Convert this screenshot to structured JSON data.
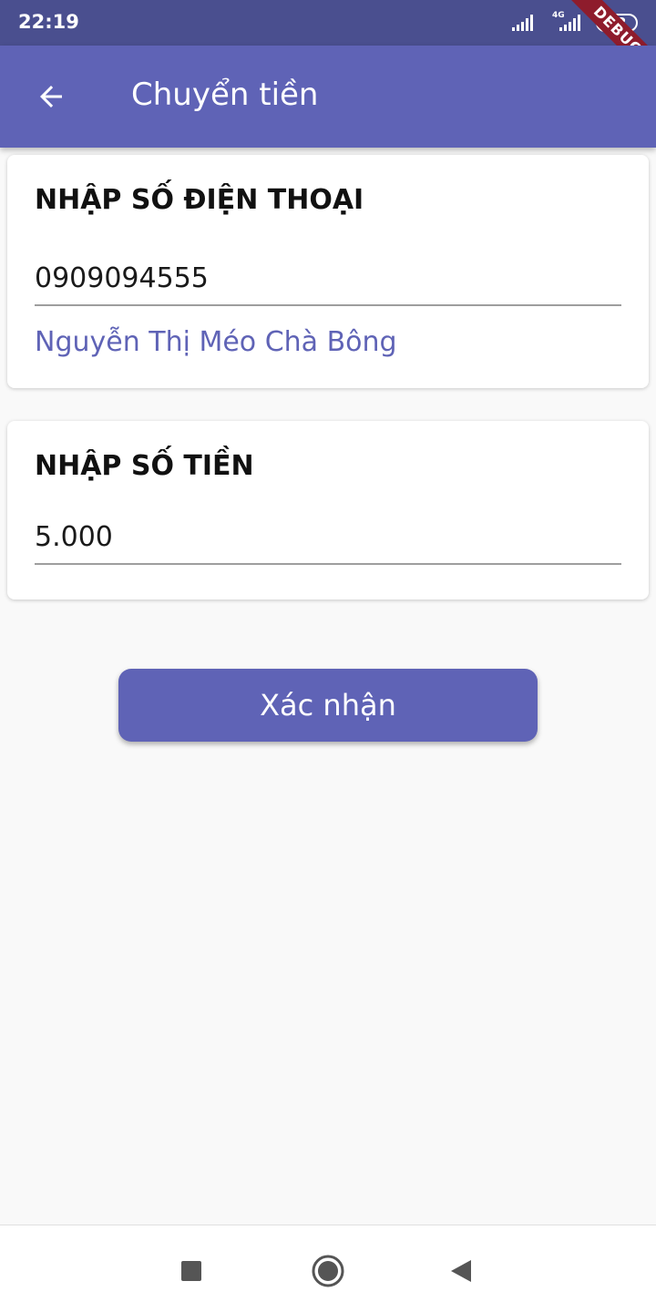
{
  "status_bar": {
    "time": "22:19",
    "network": "4G",
    "battery": "62",
    "debug_label": "DEBUG"
  },
  "app_bar": {
    "title": "Chuyển tiền",
    "back_icon": "arrow-left-icon"
  },
  "phone_card": {
    "label": "NHẬP SỐ ĐIỆN THOẠI",
    "value": "0909094555",
    "recipient_name": "Nguyễn Thị Méo Chà Bông"
  },
  "amount_card": {
    "label": "NHẬP SỐ TIỀN",
    "value": "5.000"
  },
  "confirm_button": {
    "label": "Xác nhận"
  },
  "nav_bar": {
    "icons": [
      "square-recents-icon",
      "circle-home-icon",
      "triangle-back-icon"
    ]
  },
  "colors": {
    "primary": "#5f63b6",
    "status_bar": "#4a4f8f",
    "background": "#f9f9f9",
    "debug_ribbon": "#8e1c2c"
  }
}
